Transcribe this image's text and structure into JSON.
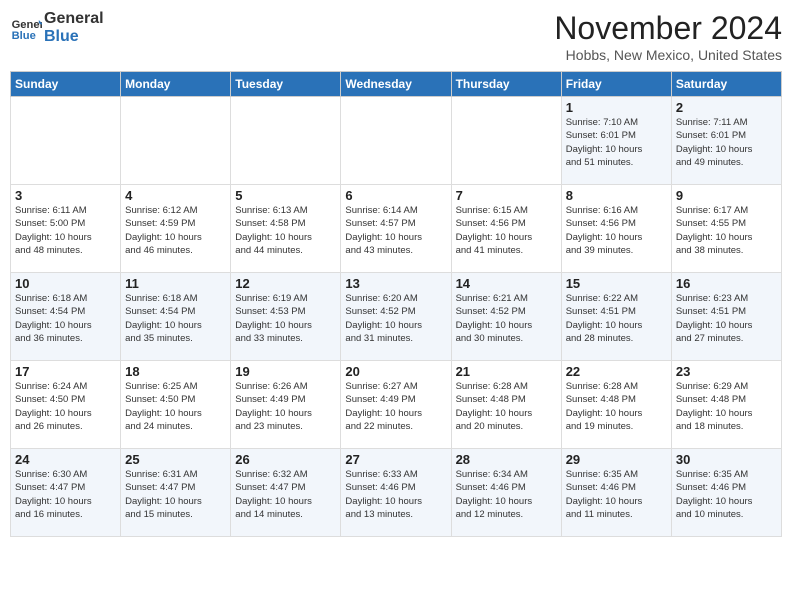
{
  "header": {
    "logo_general": "General",
    "logo_blue": "Blue",
    "month_title": "November 2024",
    "location": "Hobbs, New Mexico, United States"
  },
  "days_of_week": [
    "Sunday",
    "Monday",
    "Tuesday",
    "Wednesday",
    "Thursday",
    "Friday",
    "Saturday"
  ],
  "weeks": [
    {
      "shade": "white",
      "days": [
        {
          "num": "",
          "detail": "",
          "empty": true
        },
        {
          "num": "",
          "detail": "",
          "empty": true
        },
        {
          "num": "",
          "detail": "",
          "empty": true
        },
        {
          "num": "",
          "detail": "",
          "empty": true
        },
        {
          "num": "",
          "detail": "",
          "empty": true
        },
        {
          "num": "1",
          "detail": "Sunrise: 7:10 AM\nSunset: 6:01 PM\nDaylight: 10 hours\nand 51 minutes.",
          "empty": false
        },
        {
          "num": "2",
          "detail": "Sunrise: 7:11 AM\nSunset: 6:01 PM\nDaylight: 10 hours\nand 49 minutes.",
          "empty": false
        }
      ]
    },
    {
      "shade": "shade",
      "days": [
        {
          "num": "3",
          "detail": "Sunrise: 6:11 AM\nSunset: 5:00 PM\nDaylight: 10 hours\nand 48 minutes.",
          "empty": false
        },
        {
          "num": "4",
          "detail": "Sunrise: 6:12 AM\nSunset: 4:59 PM\nDaylight: 10 hours\nand 46 minutes.",
          "empty": false
        },
        {
          "num": "5",
          "detail": "Sunrise: 6:13 AM\nSunset: 4:58 PM\nDaylight: 10 hours\nand 44 minutes.",
          "empty": false
        },
        {
          "num": "6",
          "detail": "Sunrise: 6:14 AM\nSunset: 4:57 PM\nDaylight: 10 hours\nand 43 minutes.",
          "empty": false
        },
        {
          "num": "7",
          "detail": "Sunrise: 6:15 AM\nSunset: 4:56 PM\nDaylight: 10 hours\nand 41 minutes.",
          "empty": false
        },
        {
          "num": "8",
          "detail": "Sunrise: 6:16 AM\nSunset: 4:56 PM\nDaylight: 10 hours\nand 39 minutes.",
          "empty": false
        },
        {
          "num": "9",
          "detail": "Sunrise: 6:17 AM\nSunset: 4:55 PM\nDaylight: 10 hours\nand 38 minutes.",
          "empty": false
        }
      ]
    },
    {
      "shade": "white",
      "days": [
        {
          "num": "10",
          "detail": "Sunrise: 6:18 AM\nSunset: 4:54 PM\nDaylight: 10 hours\nand 36 minutes.",
          "empty": false
        },
        {
          "num": "11",
          "detail": "Sunrise: 6:18 AM\nSunset: 4:54 PM\nDaylight: 10 hours\nand 35 minutes.",
          "empty": false
        },
        {
          "num": "12",
          "detail": "Sunrise: 6:19 AM\nSunset: 4:53 PM\nDaylight: 10 hours\nand 33 minutes.",
          "empty": false
        },
        {
          "num": "13",
          "detail": "Sunrise: 6:20 AM\nSunset: 4:52 PM\nDaylight: 10 hours\nand 31 minutes.",
          "empty": false
        },
        {
          "num": "14",
          "detail": "Sunrise: 6:21 AM\nSunset: 4:52 PM\nDaylight: 10 hours\nand 30 minutes.",
          "empty": false
        },
        {
          "num": "15",
          "detail": "Sunrise: 6:22 AM\nSunset: 4:51 PM\nDaylight: 10 hours\nand 28 minutes.",
          "empty": false
        },
        {
          "num": "16",
          "detail": "Sunrise: 6:23 AM\nSunset: 4:51 PM\nDaylight: 10 hours\nand 27 minutes.",
          "empty": false
        }
      ]
    },
    {
      "shade": "shade",
      "days": [
        {
          "num": "17",
          "detail": "Sunrise: 6:24 AM\nSunset: 4:50 PM\nDaylight: 10 hours\nand 26 minutes.",
          "empty": false
        },
        {
          "num": "18",
          "detail": "Sunrise: 6:25 AM\nSunset: 4:50 PM\nDaylight: 10 hours\nand 24 minutes.",
          "empty": false
        },
        {
          "num": "19",
          "detail": "Sunrise: 6:26 AM\nSunset: 4:49 PM\nDaylight: 10 hours\nand 23 minutes.",
          "empty": false
        },
        {
          "num": "20",
          "detail": "Sunrise: 6:27 AM\nSunset: 4:49 PM\nDaylight: 10 hours\nand 22 minutes.",
          "empty": false
        },
        {
          "num": "21",
          "detail": "Sunrise: 6:28 AM\nSunset: 4:48 PM\nDaylight: 10 hours\nand 20 minutes.",
          "empty": false
        },
        {
          "num": "22",
          "detail": "Sunrise: 6:28 AM\nSunset: 4:48 PM\nDaylight: 10 hours\nand 19 minutes.",
          "empty": false
        },
        {
          "num": "23",
          "detail": "Sunrise: 6:29 AM\nSunset: 4:48 PM\nDaylight: 10 hours\nand 18 minutes.",
          "empty": false
        }
      ]
    },
    {
      "shade": "white",
      "days": [
        {
          "num": "24",
          "detail": "Sunrise: 6:30 AM\nSunset: 4:47 PM\nDaylight: 10 hours\nand 16 minutes.",
          "empty": false
        },
        {
          "num": "25",
          "detail": "Sunrise: 6:31 AM\nSunset: 4:47 PM\nDaylight: 10 hours\nand 15 minutes.",
          "empty": false
        },
        {
          "num": "26",
          "detail": "Sunrise: 6:32 AM\nSunset: 4:47 PM\nDaylight: 10 hours\nand 14 minutes.",
          "empty": false
        },
        {
          "num": "27",
          "detail": "Sunrise: 6:33 AM\nSunset: 4:46 PM\nDaylight: 10 hours\nand 13 minutes.",
          "empty": false
        },
        {
          "num": "28",
          "detail": "Sunrise: 6:34 AM\nSunset: 4:46 PM\nDaylight: 10 hours\nand 12 minutes.",
          "empty": false
        },
        {
          "num": "29",
          "detail": "Sunrise: 6:35 AM\nSunset: 4:46 PM\nDaylight: 10 hours\nand 11 minutes.",
          "empty": false
        },
        {
          "num": "30",
          "detail": "Sunrise: 6:35 AM\nSunset: 4:46 PM\nDaylight: 10 hours\nand 10 minutes.",
          "empty": false
        }
      ]
    }
  ]
}
